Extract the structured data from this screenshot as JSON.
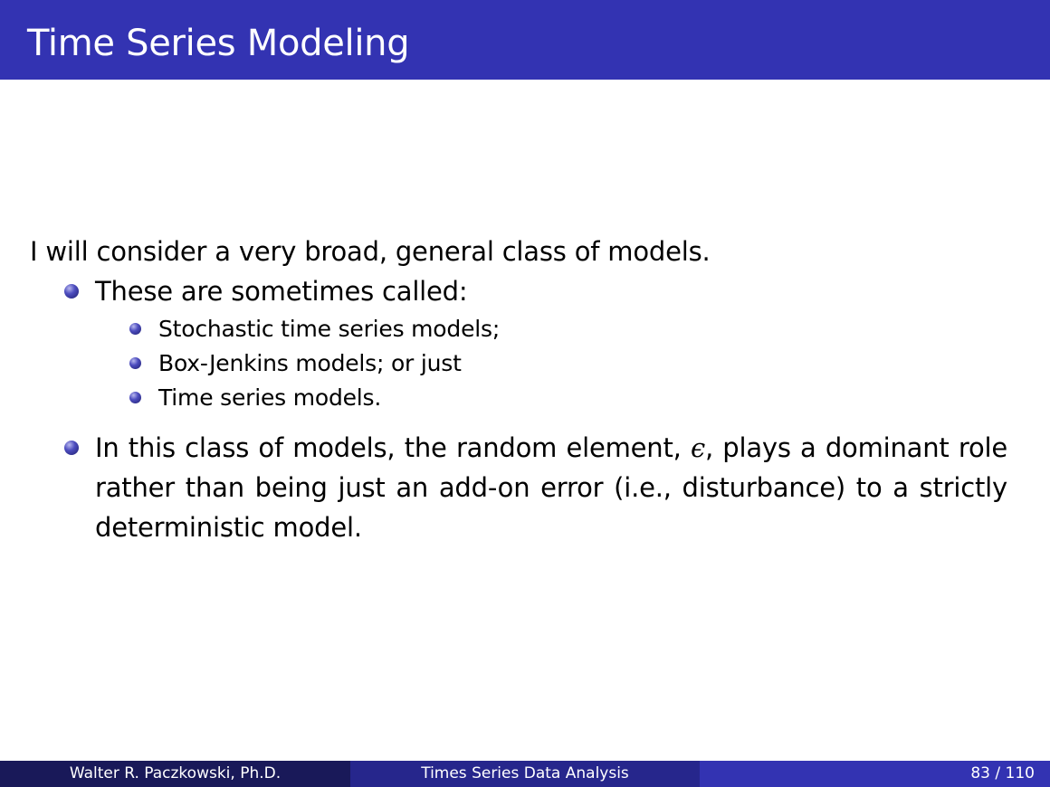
{
  "header": {
    "title": "Time Series Modeling"
  },
  "body": {
    "intro": "I will consider a very broad, general class of models.",
    "bullet1": {
      "text": "These are sometimes called:",
      "subitems": [
        "Stochastic time series models;",
        "Box-Jenkins models; or just",
        "Time series models."
      ]
    },
    "bullet2": {
      "before": "In this class of models, the random element, ",
      "symbol": "ϵ",
      "after": ", plays a dominant role rather than being just an add-on error (i.e., disturbance) to a strictly deterministic model."
    }
  },
  "footer": {
    "author": "Walter R. Paczkowski, Ph.D.",
    "deck_title": "Times Series Data Analysis",
    "page_current": "83",
    "page_separator": "/",
    "page_total": "110"
  },
  "colors": {
    "title_bar": "#3333b2",
    "footer_left": "#191959",
    "footer_middle": "#26268c",
    "footer_right": "#3333b2",
    "bullet": "#4d4dbf"
  },
  "icons": {
    "bullet": "ball-bullet-icon"
  }
}
